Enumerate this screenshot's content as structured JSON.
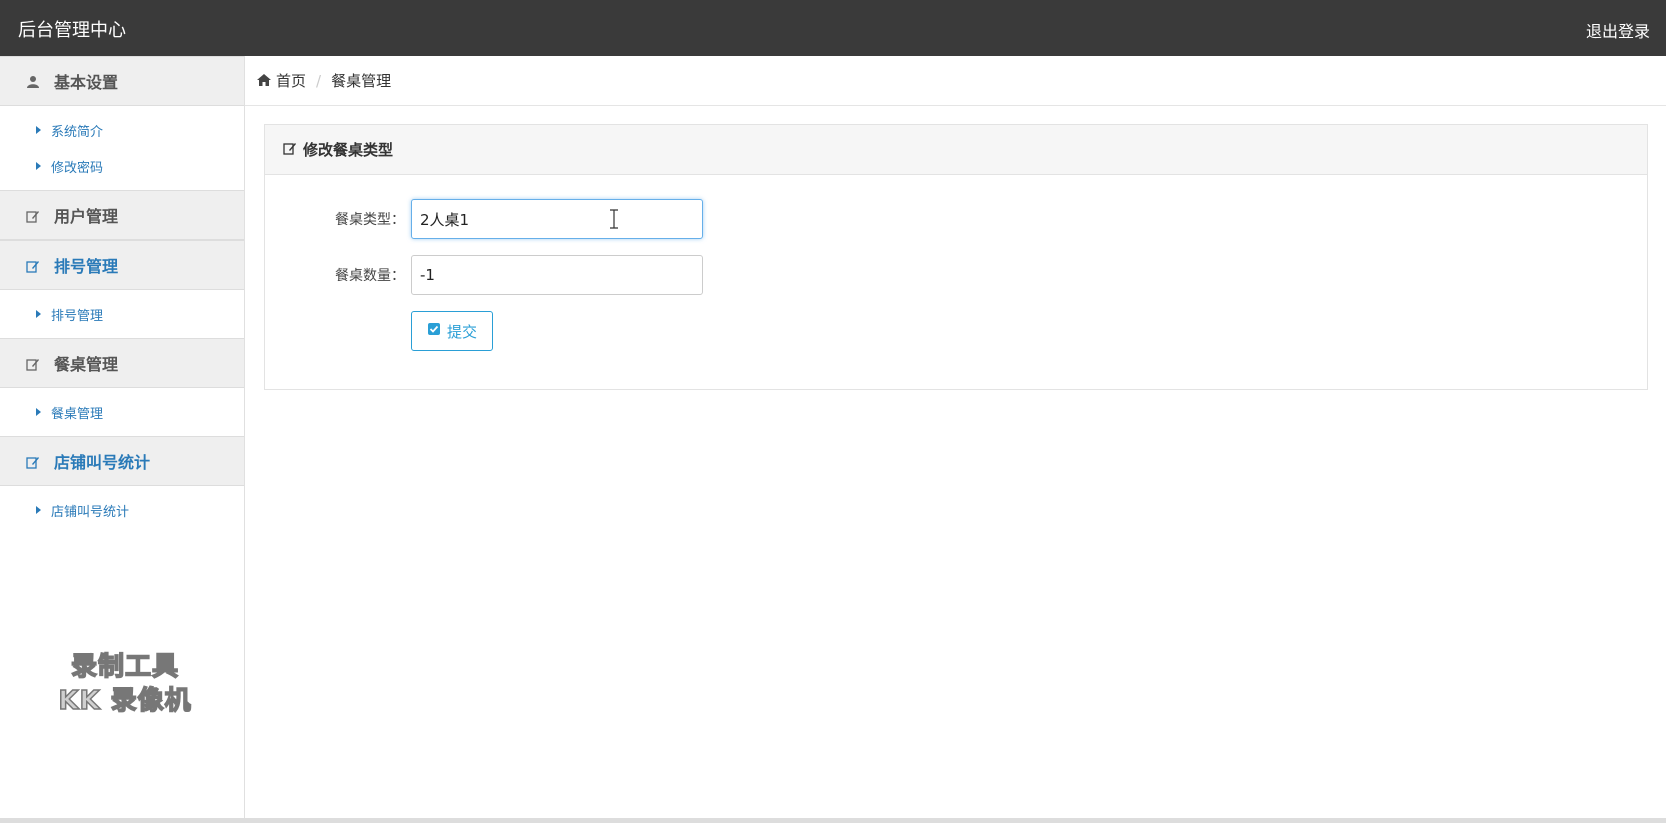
{
  "header": {
    "app_title": "后台管理中心",
    "logout_label": "退出登录"
  },
  "sidebar": {
    "groups": [
      {
        "label": "基本设置",
        "icon": "user-icon",
        "items": [
          "系统简介",
          "修改密码"
        ]
      },
      {
        "label": "用户管理",
        "icon": "edit-icon",
        "items": []
      },
      {
        "label": "排号管理",
        "icon": "edit-icon",
        "items": [
          "排号管理"
        ]
      },
      {
        "label": "餐桌管理",
        "icon": "edit-icon",
        "items": [
          "餐桌管理"
        ]
      },
      {
        "label": "店铺叫号统计",
        "icon": "edit-icon",
        "items": [
          "店铺叫号统计"
        ]
      }
    ]
  },
  "watermark": {
    "line1": "录制工具",
    "line2": "KK 录像机"
  },
  "breadcrumb": {
    "home": "首页",
    "separator": "/",
    "current": "餐桌管理"
  },
  "panel": {
    "title": "修改餐桌类型",
    "fields": [
      {
        "label": "餐桌类型：",
        "value": "2人桌1"
      },
      {
        "label": "餐桌数量：",
        "value": "-1"
      }
    ],
    "submit_label": "提交"
  },
  "colors": {
    "topbar": "#3a3a3a",
    "accent": "#2a7ab8",
    "button": "#2a9fd6"
  }
}
